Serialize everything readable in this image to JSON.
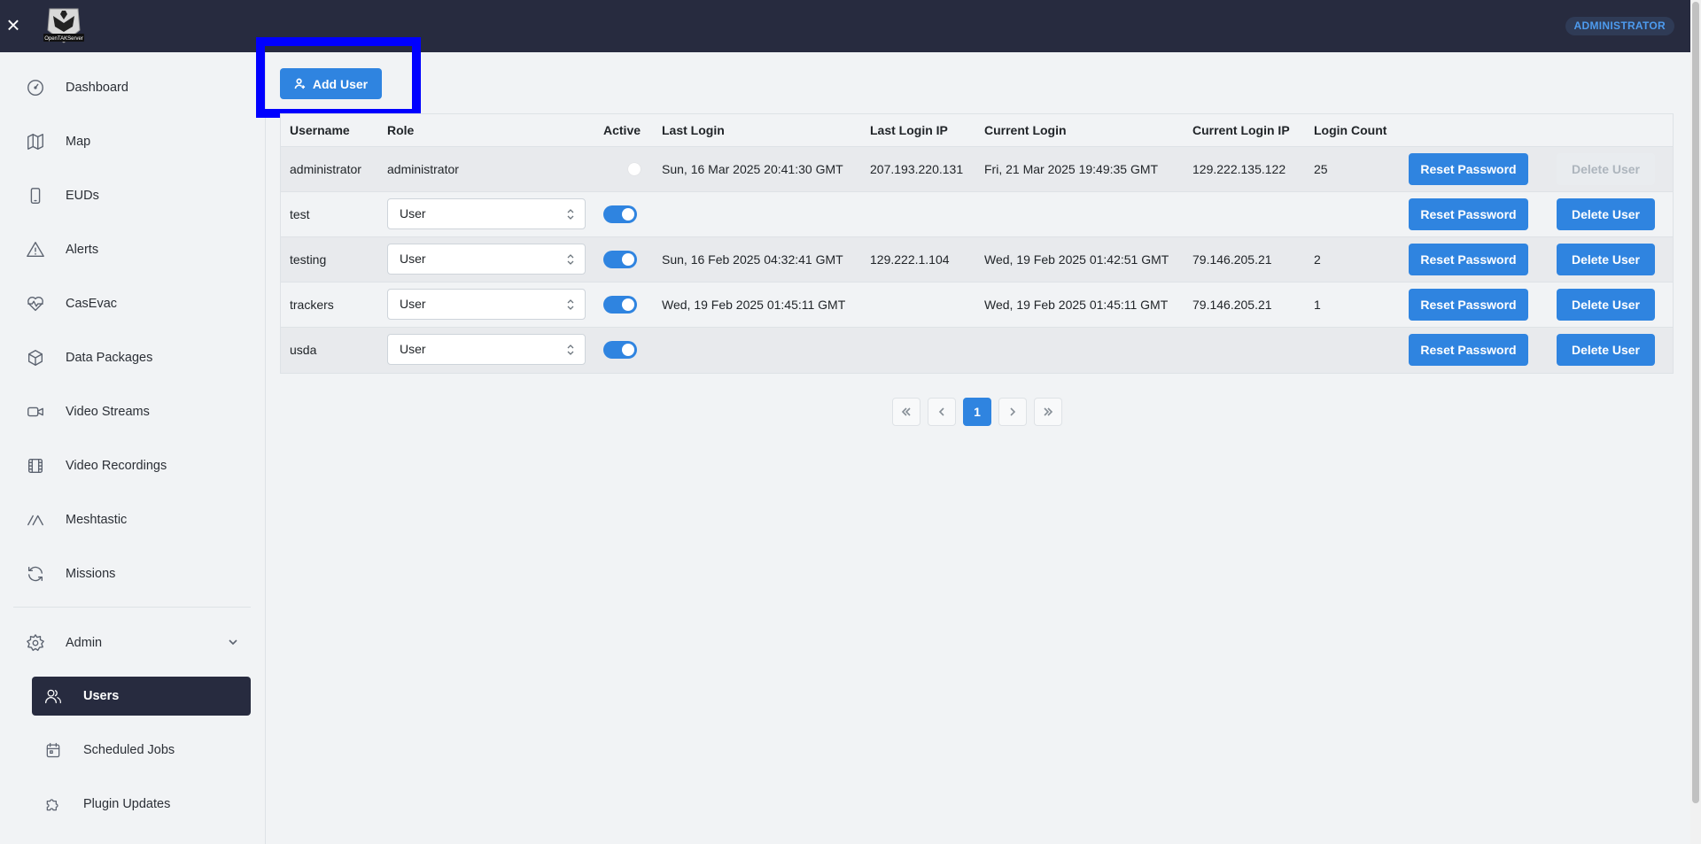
{
  "header": {
    "logo_text": "OpenTAKServer",
    "role_badge": "ADMINISTRATOR"
  },
  "sidebar": {
    "items": [
      {
        "label": "Dashboard",
        "icon": "dashboard-icon"
      },
      {
        "label": "Map",
        "icon": "map-icon"
      },
      {
        "label": "EUDs",
        "icon": "phone-icon"
      },
      {
        "label": "Alerts",
        "icon": "alert-icon"
      },
      {
        "label": "CasEvac",
        "icon": "heart-pulse-icon"
      },
      {
        "label": "Data Packages",
        "icon": "package-icon"
      },
      {
        "label": "Video Streams",
        "icon": "video-icon"
      },
      {
        "label": "Video Recordings",
        "icon": "film-icon"
      },
      {
        "label": "Meshtastic",
        "icon": "mesh-icon"
      },
      {
        "label": "Missions",
        "icon": "refresh-icon"
      }
    ],
    "admin": {
      "label": "Admin",
      "items": [
        {
          "label": "Users",
          "icon": "users-icon",
          "active": true
        },
        {
          "label": "Scheduled Jobs",
          "icon": "calendar-icon",
          "active": false
        },
        {
          "label": "Plugin Updates",
          "icon": "puzzle-icon",
          "active": false
        }
      ]
    }
  },
  "toolbar": {
    "add_user_label": "Add User"
  },
  "table": {
    "columns": [
      "Username",
      "Role",
      "Active",
      "Last Login",
      "Last Login IP",
      "Current Login",
      "Current Login IP",
      "Login Count"
    ],
    "reset_label": "Reset Password",
    "delete_label": "Delete User",
    "rows": [
      {
        "username": "administrator",
        "role": "administrator",
        "role_editable": false,
        "active": false,
        "last_login": "Sun, 16 Mar 2025 20:41:30 GMT",
        "last_login_ip": "207.193.220.131",
        "current_login": "Fri, 21 Mar 2025 19:49:35 GMT",
        "current_login_ip": "129.222.135.122",
        "login_count": "25",
        "delete_enabled": false
      },
      {
        "username": "test",
        "role": "User",
        "role_editable": true,
        "active": true,
        "last_login": "",
        "last_login_ip": "",
        "current_login": "",
        "current_login_ip": "",
        "login_count": "",
        "delete_enabled": true
      },
      {
        "username": "testing",
        "role": "User",
        "role_editable": true,
        "active": true,
        "last_login": "Sun, 16 Feb 2025 04:32:41 GMT",
        "last_login_ip": "129.222.1.104",
        "current_login": "Wed, 19 Feb 2025 01:42:51 GMT",
        "current_login_ip": "79.146.205.21",
        "login_count": "2",
        "delete_enabled": true
      },
      {
        "username": "trackers",
        "role": "User",
        "role_editable": true,
        "active": true,
        "last_login": "Wed, 19 Feb 2025 01:45:11 GMT",
        "last_login_ip": "",
        "current_login": "Wed, 19 Feb 2025 01:45:11 GMT",
        "current_login_ip": "79.146.205.21",
        "login_count": "1",
        "delete_enabled": true
      },
      {
        "username": "usda",
        "role": "User",
        "role_editable": true,
        "active": true,
        "last_login": "",
        "last_login_ip": "",
        "current_login": "",
        "current_login_ip": "",
        "login_count": "",
        "delete_enabled": true
      }
    ]
  },
  "pagination": {
    "current_page": "1"
  },
  "colors": {
    "header_bg": "#272b3f",
    "accent": "#2f84e0",
    "highlight": "#0000ff"
  }
}
